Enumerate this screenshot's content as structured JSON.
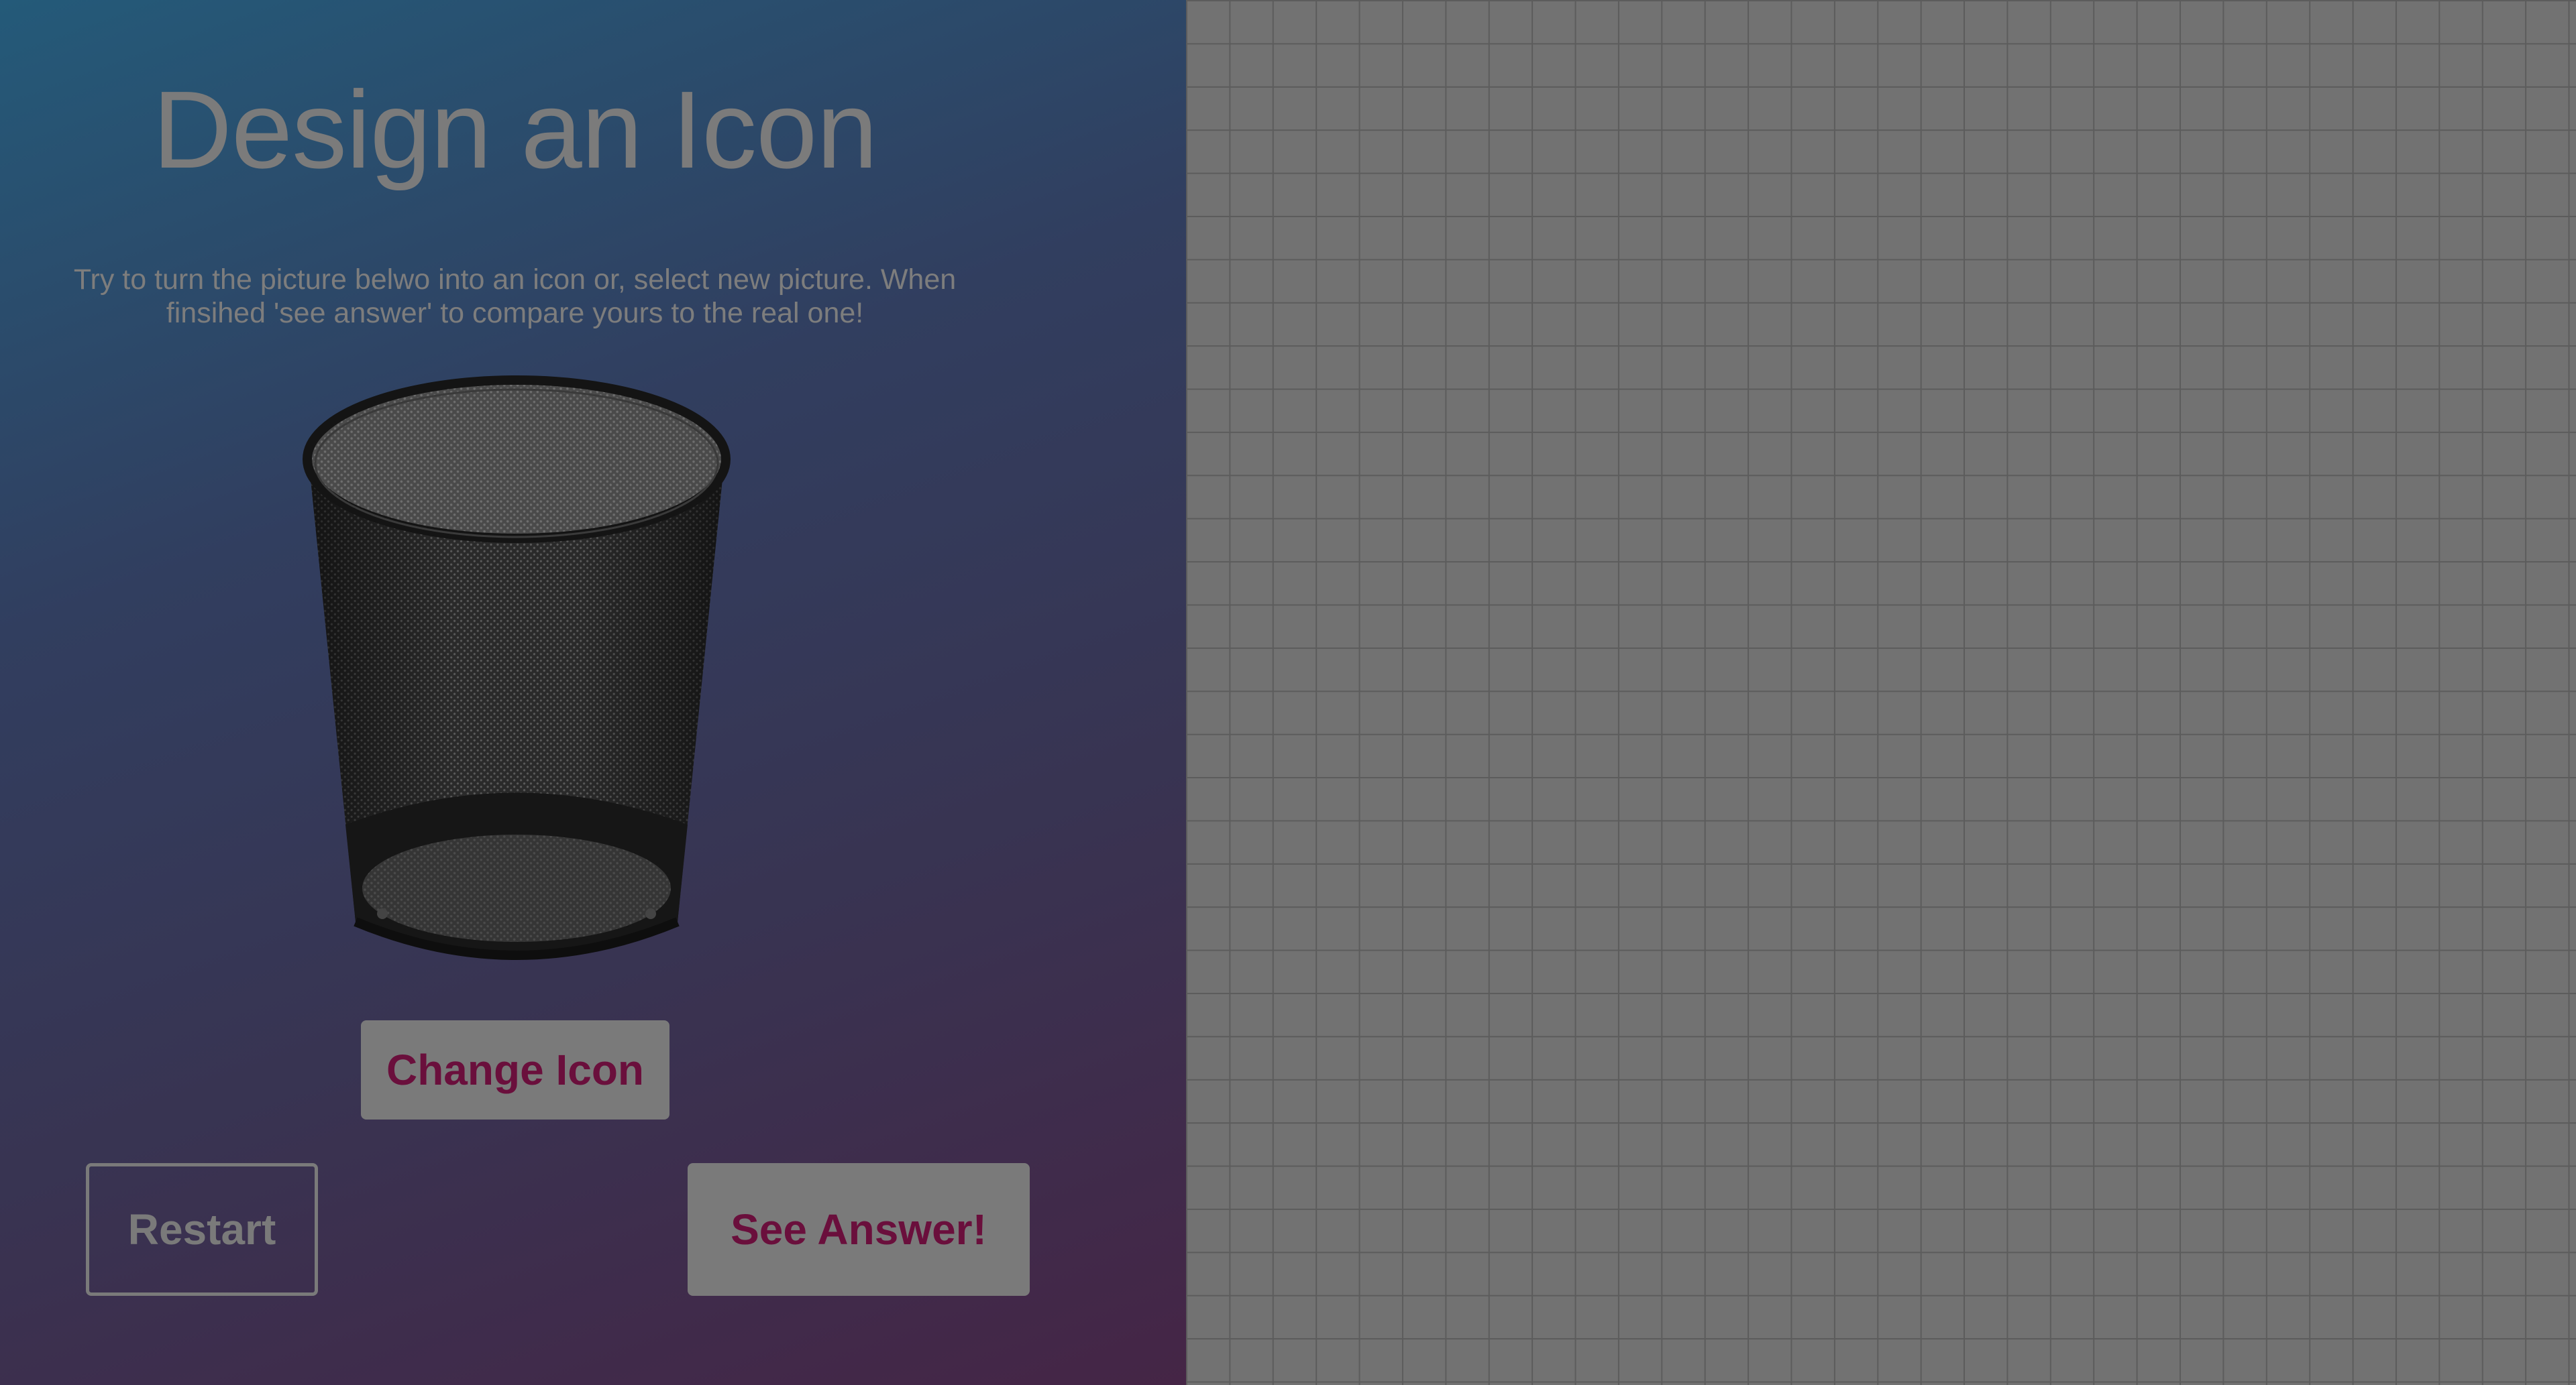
{
  "left_panel": {
    "title": "Design an Icon",
    "instructions": "Try to turn the picture belwo into an icon or, select new picture. When finsihed 'see answer' to compare yours to the real one!",
    "picture": {
      "icon": "wastebasket-image"
    },
    "buttons": {
      "change_icon": "Change Icon",
      "restart": "Restart",
      "see_answer": "See Answer!"
    }
  },
  "right_panel": {
    "canvas": "drawing-grid"
  },
  "colors": {
    "text_dim": "#7b7b7b",
    "button_bg": "#7a7a7a",
    "button_text": "#6a0f3c",
    "grid_bg": "#727272",
    "grid_line": "#5c5c5c"
  }
}
